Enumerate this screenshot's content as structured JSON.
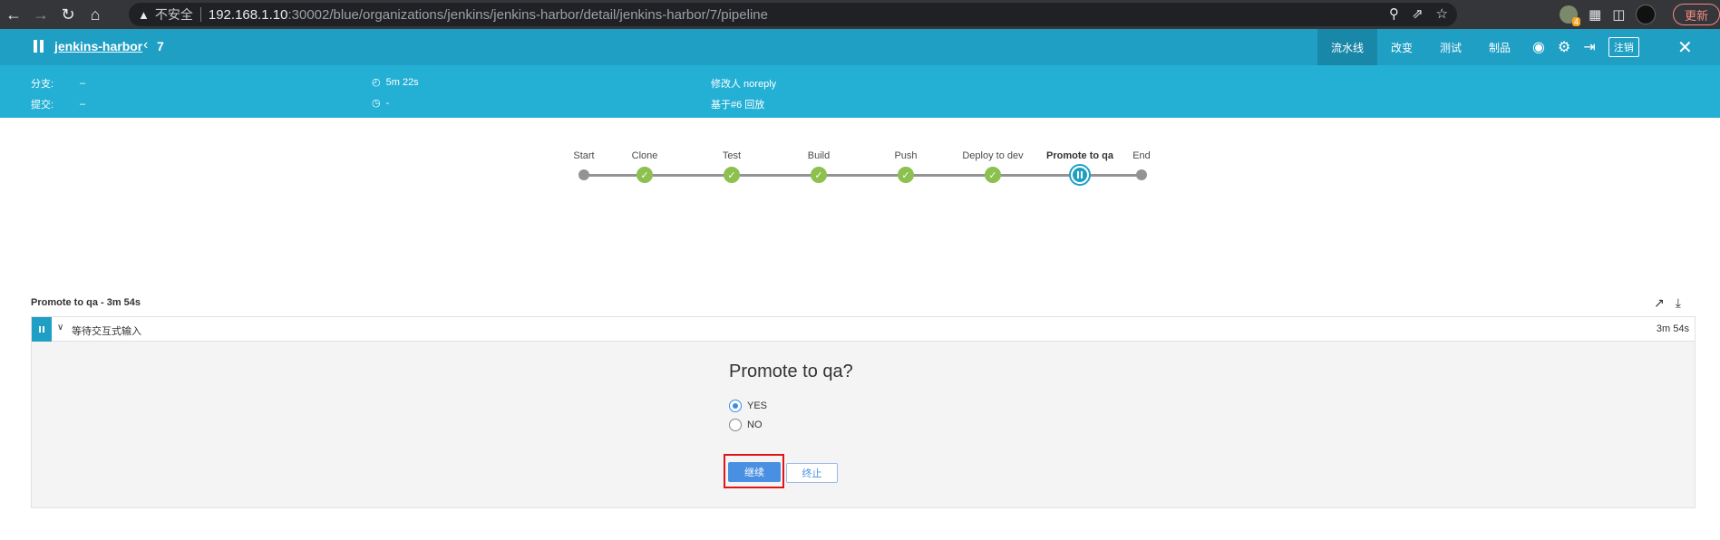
{
  "browser": {
    "insecure_label": "不安全",
    "url_host": "192.168.1.10",
    "url_path": ":30002/blue/organizations/jenkins/jenkins-harbor/detail/jenkins-harbor/7/pipeline",
    "ext_badge_count": "4",
    "update_label": "更新"
  },
  "header": {
    "job_name": "jenkins-harbor",
    "run_number": "7",
    "tabs": [
      "流水线",
      "改变",
      "测试",
      "制品"
    ],
    "logout_label": "注销"
  },
  "info": {
    "branch_label": "分支:",
    "branch_value": "–",
    "commit_label": "提交:",
    "commit_value": "–",
    "duration": "5m 22s",
    "time_ago": "-",
    "changed_by": "修改人 noreply",
    "replay_of": "基于#6 回放"
  },
  "pipeline": {
    "stages": [
      {
        "label": "Start",
        "status": "start"
      },
      {
        "label": "Clone",
        "status": "success"
      },
      {
        "label": "Test",
        "status": "success"
      },
      {
        "label": "Build",
        "status": "success"
      },
      {
        "label": "Push",
        "status": "success"
      },
      {
        "label": "Deploy to dev",
        "status": "success"
      },
      {
        "label": "Promote to qa",
        "status": "paused"
      },
      {
        "label": "End",
        "status": "end"
      }
    ]
  },
  "step": {
    "title": "Promote to qa - 3m 54s",
    "row_name": "等待交互式输入",
    "row_duration": "3m 54s",
    "question": "Promote to qa?",
    "options": [
      "YES",
      "NO"
    ],
    "selected_option": "YES",
    "proceed_label": "继续",
    "abort_label": "终止"
  },
  "colors": {
    "header_bg": "#1f9fc4",
    "info_bg": "#24b0d5",
    "success": "#8cc04f",
    "primary_button": "#4a90e2",
    "highlight_border": "#e0151b"
  }
}
